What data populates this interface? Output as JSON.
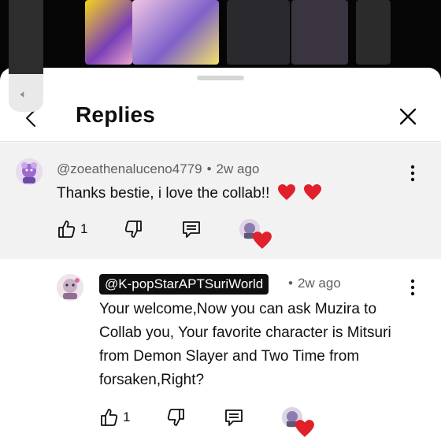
{
  "header": {
    "title": "Replies"
  },
  "parent_comment": {
    "author": "@zoeathenaluceno4779",
    "separator": "•",
    "time": "2w ago",
    "text": "Thanks bestie, i love the collab!!",
    "like_count": "1"
  },
  "reply": {
    "author": "@K-popStarAPTSuriWorld",
    "separator": "•",
    "time": "2w ago",
    "text": "Your welcome,Now you can ask Muzira to Collab you, Your favorite character is Mitsuri from Demon Slayer and Two Time from forsaken,Right?",
    "like_count": "1"
  },
  "colors": {
    "heart": "#e0202a",
    "chip_bg": "#0f0f0f",
    "meta_text": "#606060",
    "parent_bg": "#f2f2f2"
  },
  "icons": [
    "back-icon",
    "close-icon",
    "like-icon",
    "dislike-icon",
    "reply-icon",
    "more-icon",
    "heart-icon",
    "volume-icon"
  ]
}
